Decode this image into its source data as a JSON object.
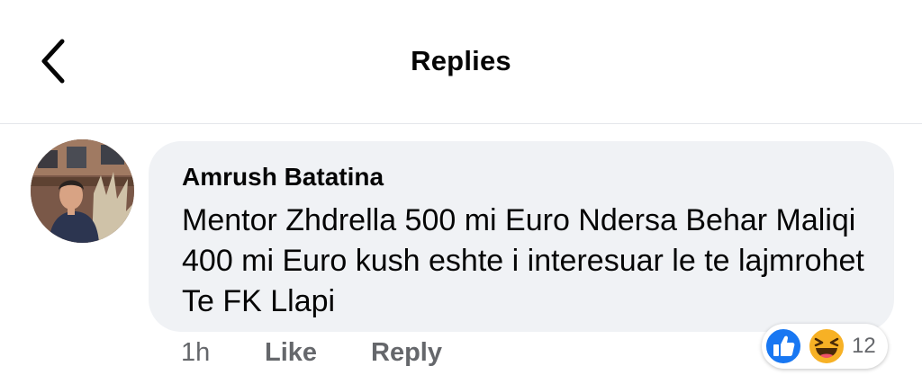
{
  "header": {
    "title": "Replies",
    "back_icon": "chevron-left-icon"
  },
  "comment": {
    "author": "Amrush Batatina",
    "text": "Mentor Zhdrella 500 mi Euro Ndersa Behar Maliqi 400 mi Euro kush eshte i interesuar le te lajmrohet Te FK Llapi",
    "time": "1h",
    "like_label": "Like",
    "reply_label": "Reply",
    "reactions": {
      "icons": [
        "like-reaction-icon",
        "haha-reaction-icon"
      ],
      "count": "12"
    }
  },
  "colors": {
    "bubble": "#f0f2f5",
    "secondary_text": "#65676b",
    "like_blue": "#1877f2",
    "haha_yellow": "#f7b125"
  }
}
